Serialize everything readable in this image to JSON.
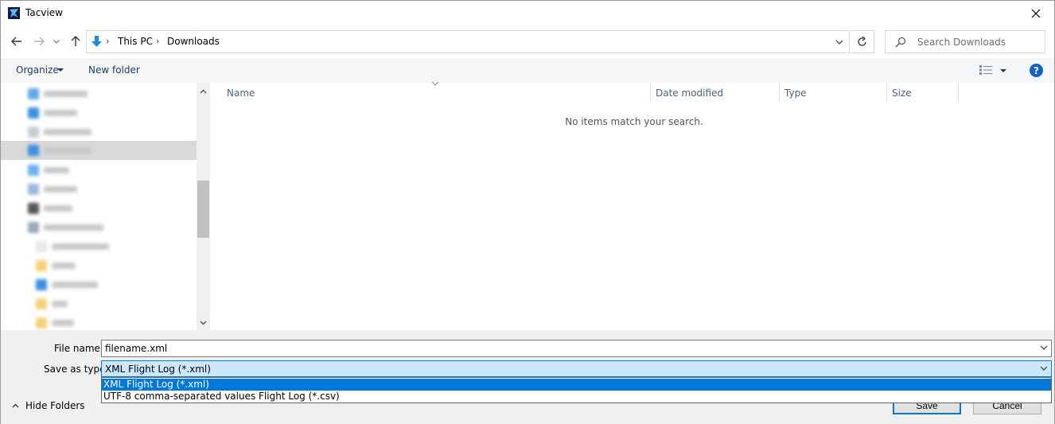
{
  "window": {
    "title": "Tacview"
  },
  "address": {
    "breadcrumbs": [
      "This PC",
      "Downloads"
    ],
    "search_placeholder": "Search Downloads"
  },
  "toolbar": {
    "organize_label": "Organize",
    "new_folder_label": "New folder",
    "help_label": "?"
  },
  "nav_pane": {
    "selected_index": 3,
    "items_blurred": true,
    "item_count": 13
  },
  "file_list": {
    "columns": [
      "Name",
      "Date modified",
      "Type",
      "Size"
    ],
    "empty_message": "No items match your search."
  },
  "save_panel": {
    "file_name_label": "File name:",
    "file_name_value": "filename.xml",
    "save_as_type_label": "Save as type:",
    "save_as_type_value": "XML Flight Log (*.xml)",
    "type_options": [
      "XML Flight Log (*.xml)",
      "UTF-8 comma-separated values Flight Log (*.csv)"
    ],
    "selected_option_index": 0,
    "hide_folders_label": "Hide Folders",
    "save_button": "Save",
    "cancel_button": "Cancel"
  },
  "colors": {
    "accent": "#0078d7",
    "selected_option_bg": "#0078d7",
    "combo_focus_bg": "#cce8ff",
    "link_text": "#1e395b"
  }
}
